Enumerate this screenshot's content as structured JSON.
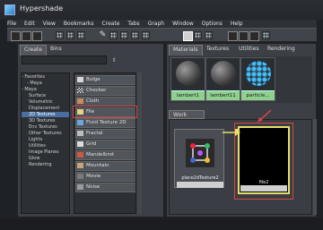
{
  "window": {
    "title": "Hypershade"
  },
  "menu": [
    "File",
    "Edit",
    "View",
    "Bookmarks",
    "Create",
    "Tabs",
    "Graph",
    "Window",
    "Options",
    "Help"
  ],
  "left_tabs": [
    "Create",
    "Bins"
  ],
  "tree": [
    {
      "label": "Favorites",
      "selected": false,
      "expander": "-"
    },
    {
      "label": "- Maya",
      "selected": false,
      "expander": ""
    },
    {
      "label": "Maya",
      "selected": false,
      "expander": "-"
    },
    {
      "label": "Surface",
      "selected": false,
      "expander": ""
    },
    {
      "label": "Volumetric",
      "selected": false,
      "expander": ""
    },
    {
      "label": "Displacement",
      "selected": false,
      "expander": ""
    },
    {
      "label": "2D Textures",
      "selected": true,
      "expander": ""
    },
    {
      "label": "3D Textures",
      "selected": false,
      "expander": ""
    },
    {
      "label": "Env Textures",
      "selected": false,
      "expander": ""
    },
    {
      "label": "Other Textures",
      "selected": false,
      "expander": ""
    },
    {
      "label": "Lights",
      "selected": false,
      "expander": ""
    },
    {
      "label": "Utilities",
      "selected": false,
      "expander": ""
    },
    {
      "label": "Image Planes",
      "selected": false,
      "expander": ""
    },
    {
      "label": "Glow",
      "selected": false,
      "expander": ""
    },
    {
      "label": "Rendering",
      "selected": false,
      "expander": ""
    }
  ],
  "textures": [
    {
      "label": "Bulge",
      "icon": "bulge-icon",
      "color": "#d7d7d7"
    },
    {
      "label": "Checker",
      "icon": "checker-icon",
      "color": "#ffffff"
    },
    {
      "label": "Cloth",
      "icon": "cloth-icon",
      "color": "#c98a5c"
    },
    {
      "label": "File",
      "icon": "file-icon",
      "color": "#e6d37a"
    },
    {
      "label": "Fluid Texture 2D",
      "icon": "fluid-icon",
      "color": "#6aa7e0"
    },
    {
      "label": "Fractal",
      "icon": "fractal-icon",
      "color": "#bdbdbd"
    },
    {
      "label": "Grid",
      "icon": "grid-icon",
      "color": "#dddddd"
    },
    {
      "label": "Mandelbrot",
      "icon": "mandelbrot-icon",
      "color": "#d05a3a"
    },
    {
      "label": "Mountain",
      "icon": "mountain-icon",
      "color": "#caa37a"
    },
    {
      "label": "Movie",
      "icon": "movie-icon",
      "color": "#7a7a7a"
    },
    {
      "label": "Noise",
      "icon": "noise-icon",
      "color": "#9c9c9c"
    }
  ],
  "right_tabs": [
    "Materials",
    "Textures",
    "Utilities",
    "Rendering"
  ],
  "shaders": [
    {
      "label": "lambert1",
      "style": "gray"
    },
    {
      "label": "lambert11",
      "style": "gray"
    },
    {
      "label": "particle...",
      "style": "blue"
    }
  ],
  "work_area": {
    "tab_label": "Work Area",
    "nodes": [
      {
        "label": "place2dTexture2"
      },
      {
        "label": "file2"
      }
    ]
  },
  "colors": {
    "selection_blue": "#4b6da0",
    "highlight_red": "#d84545",
    "node_yellow": "#e6e06a",
    "shader_label_green": "#8fd08f"
  }
}
